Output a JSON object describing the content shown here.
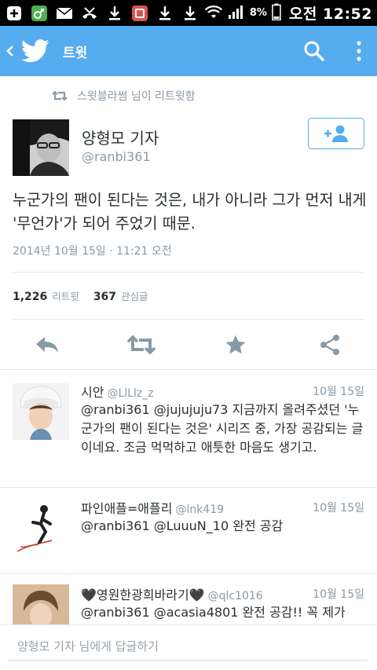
{
  "statusbar": {
    "icons": [
      "add-box-icon",
      "green-app-icon",
      "mail-icon",
      "missed-call-icon",
      "download-icon",
      "red-app-icon",
      "download-icon",
      "download-icon"
    ],
    "battery_pct": "8%",
    "time": "오전 12:52"
  },
  "actionbar": {
    "title": "트윗",
    "color": "#55acee"
  },
  "retweet_context": "스윗블라썸 님이 리트윗함",
  "tweet": {
    "author_name": "양형모 기자",
    "author_handle": "@ranbi361",
    "text": "누군가의 팬이 된다는 것은, 내가 아니라 그가 먼저 내게 '무언가'가 되어 주었기 때문.",
    "timestamp": "2014년 10월 15일 · 11:21 오전",
    "retweets_count": "1,226",
    "retweets_label": "리트윗",
    "favorites_count": "367",
    "favorites_label": "관심글"
  },
  "replies": [
    {
      "name": "시안",
      "handle": "@LlLlz_z",
      "date": "10월 15일",
      "text": "@ranbi361 @jujujuju73 지금까지 올려주셨던 '누군가의 팬이 된다는 것은' 시리즈 중, 가장 공감되는 글이네요. 조금 먹먹하고 애틋한 마음도 생기고."
    },
    {
      "name": "파인애플=애플리",
      "handle": "@lnk419",
      "date": "10월 15일",
      "text": "@ranbi361 @LuuuN_10 완전 공감"
    },
    {
      "name": "🖤영원한광희바라기🖤",
      "handle": "@qlc1016",
      "date": "10월 15일",
      "text": "@ranbi361 @acasia4801 완전 공감!! 꼭 제가"
    }
  ],
  "reply_bar": {
    "placeholder": "양형모 기자 님에게 답글하기"
  }
}
